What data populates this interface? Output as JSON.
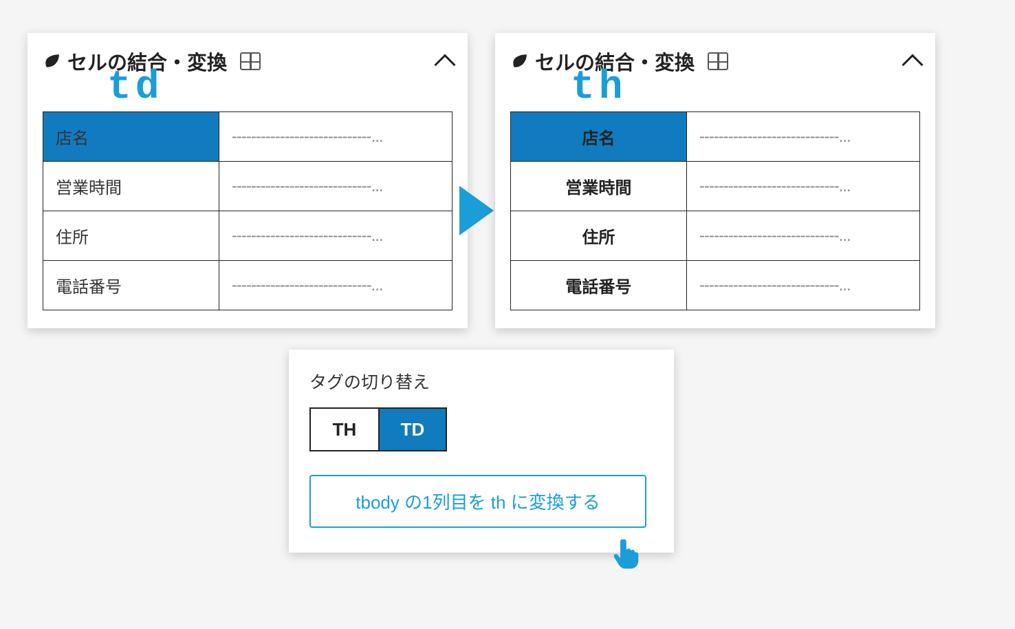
{
  "panels": {
    "left": {
      "title": "セルの結合・変換",
      "overlay": "td",
      "rows": [
        {
          "label": "店名",
          "value": "-----------------------------...",
          "highlight": true
        },
        {
          "label": "営業時間",
          "value": "-----------------------------...",
          "highlight": false
        },
        {
          "label": "住所",
          "value": "-----------------------------...",
          "highlight": false
        },
        {
          "label": "電話番号",
          "value": "-----------------------------...",
          "highlight": false
        }
      ]
    },
    "right": {
      "title": "セルの結合・変換",
      "overlay": "th",
      "rows": [
        {
          "label": "店名",
          "value": "-----------------------------...",
          "highlight": true
        },
        {
          "label": "営業時間",
          "value": "-----------------------------...",
          "highlight": false
        },
        {
          "label": "住所",
          "value": "-----------------------------...",
          "highlight": false
        },
        {
          "label": "電話番号",
          "value": "-----------------------------...",
          "highlight": false
        }
      ]
    }
  },
  "toggle_panel": {
    "section_label": "タグの切り替え",
    "options": [
      {
        "label": "TH",
        "active": false
      },
      {
        "label": "TD",
        "active": true
      }
    ],
    "action_button": "tbody の1列目を th に変換する"
  }
}
